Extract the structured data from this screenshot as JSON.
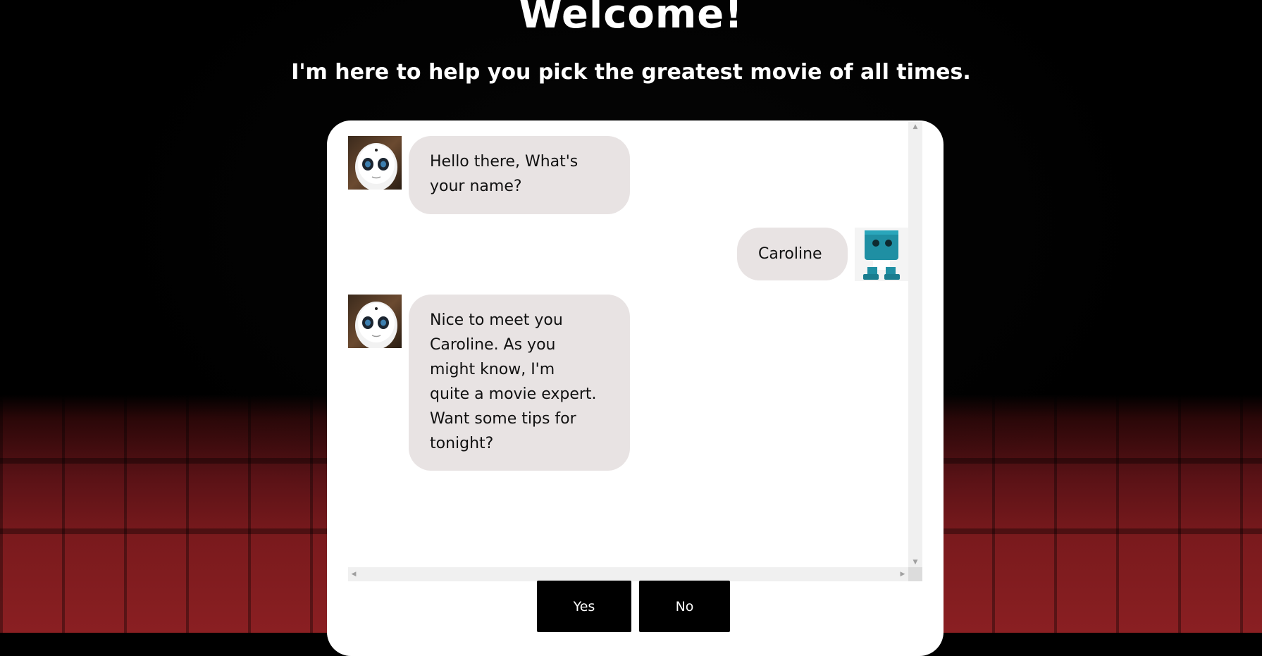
{
  "header": {
    "title": "Welcome!",
    "subtitle": "I'm here to help you pick the greatest movie of all times."
  },
  "chat": {
    "messages": [
      {
        "sender": "bot",
        "avatar": "white-humanoid-robot-icon",
        "text_lines": [
          "Hello there, What's",
          "your name?"
        ]
      },
      {
        "sender": "user",
        "avatar": "teal-cube-robot-icon",
        "text_lines": [
          "Caroline"
        ]
      },
      {
        "sender": "bot",
        "avatar": "white-humanoid-robot-icon",
        "text_lines": [
          "Nice to meet you",
          "Caroline. As you",
          "might know, I'm",
          "quite a movie expert.",
          "Want some tips for",
          "tonight?"
        ]
      }
    ]
  },
  "actions": {
    "yes_label": "Yes",
    "no_label": "No"
  },
  "colors": {
    "page_background": "#000000",
    "card_background": "#ffffff",
    "bubble_background": "#e8e3e3",
    "button_background": "#000000",
    "seat_red": "#7a1a1d"
  }
}
